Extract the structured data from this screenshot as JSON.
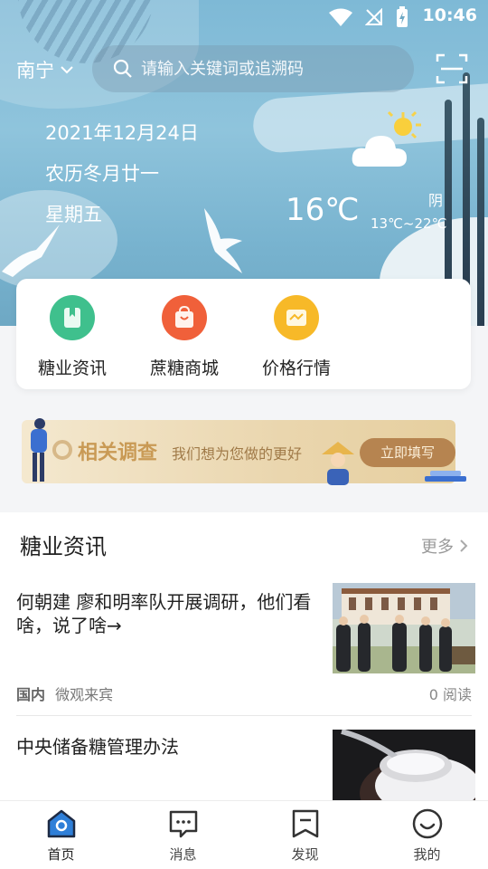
{
  "status": {
    "time": "10:46"
  },
  "header": {
    "city": "南宁",
    "search_placeholder": "请输入关键词或追溯码"
  },
  "date": {
    "gregorian": "2021年12月24日",
    "lunar": "农历冬月廿一",
    "weekday": "星期五"
  },
  "weather": {
    "temperature": "16℃",
    "condition": "阴",
    "range": "13℃~22℃"
  },
  "quick_menu": [
    {
      "label": "糖业资讯",
      "icon": "book-icon",
      "color": "#3fc08d"
    },
    {
      "label": "蔗糖商城",
      "icon": "shopping-bag-icon",
      "color": "#f0603a"
    },
    {
      "label": "价格行情",
      "icon": "chart-icon",
      "color": "#f7b928"
    }
  ],
  "banner": {
    "title": "相关调查",
    "subtitle": "我们想为您做的更好",
    "button": "立即填写"
  },
  "news": {
    "section_title": "糖业资讯",
    "more_label": "更多",
    "items": [
      {
        "title": "何朝建 廖和明率队开展调研，他们看啥，说了啥→",
        "category": "国内",
        "source": "微观来宾",
        "reads": "0 阅读"
      },
      {
        "title": "中央储备糖管理办法"
      }
    ]
  },
  "tabbar": [
    {
      "label": "首页",
      "icon": "home-icon",
      "active": true
    },
    {
      "label": "消息",
      "icon": "message-icon",
      "active": false
    },
    {
      "label": "发现",
      "icon": "discover-icon",
      "active": false
    },
    {
      "label": "我的",
      "icon": "profile-icon",
      "active": false
    }
  ]
}
